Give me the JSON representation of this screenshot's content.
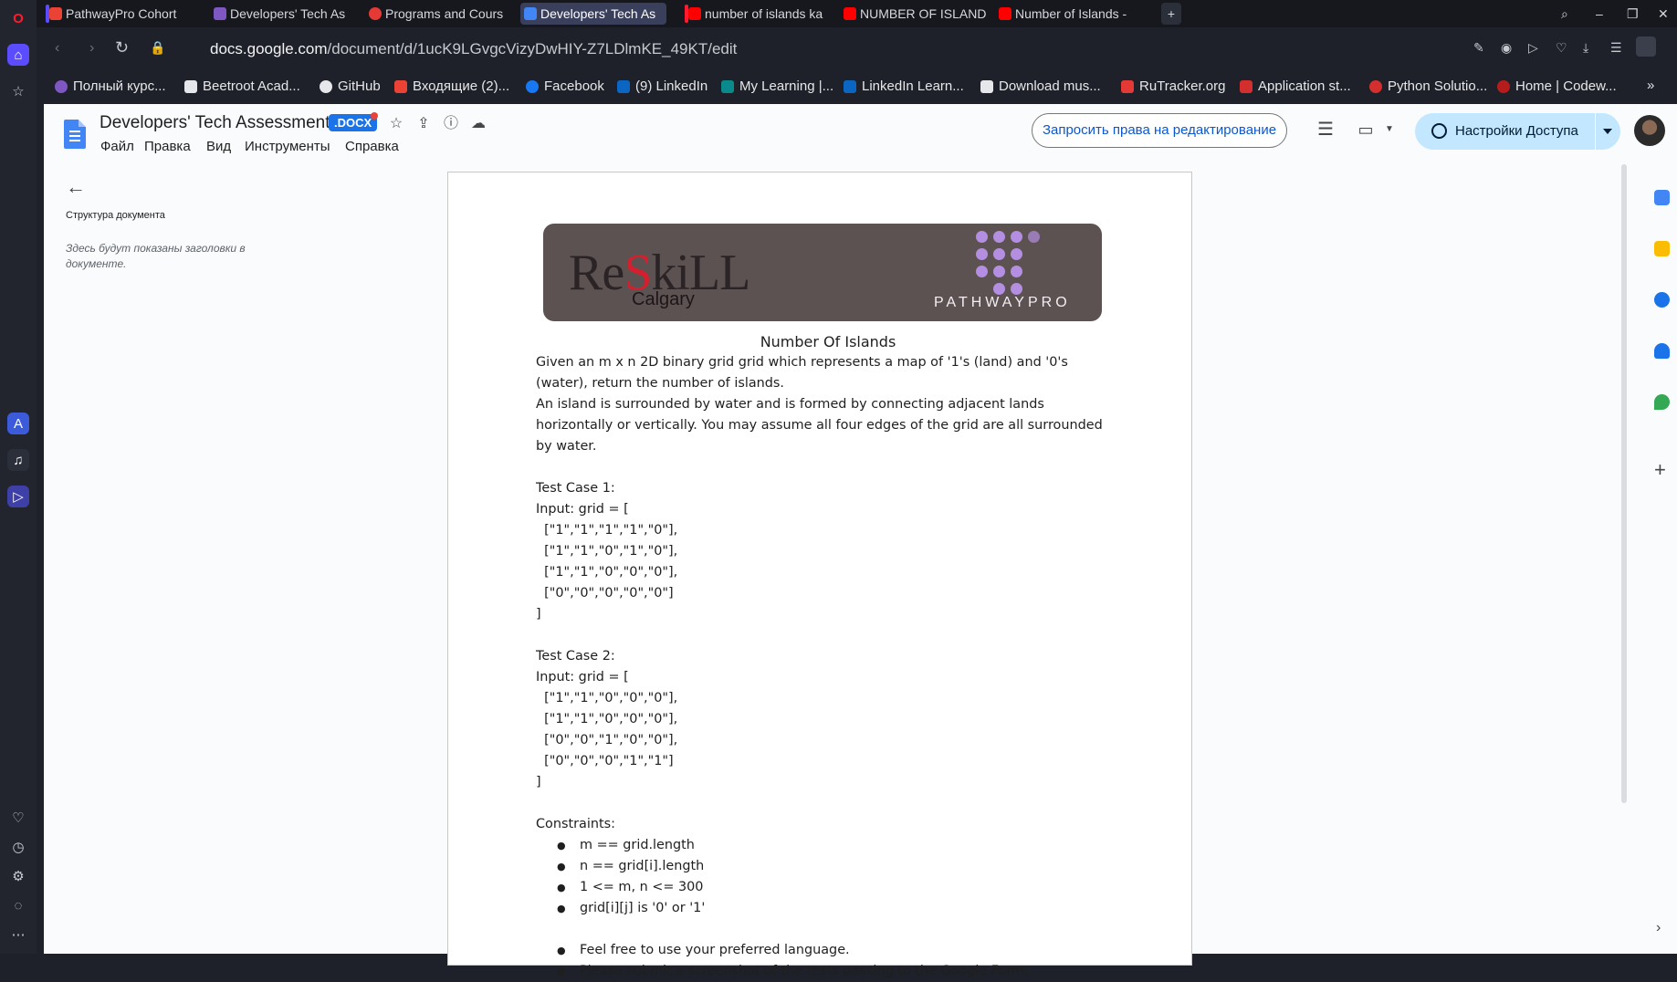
{
  "browser": {
    "tabs": [
      {
        "label": "PathwayPro Cohort",
        "color": "#ea4335"
      },
      {
        "label": "Developers' Tech As",
        "color": "#7e57c2"
      },
      {
        "label": "Programs and Cours",
        "color": "#e53935"
      },
      {
        "label": "Developers' Tech As",
        "color": "#4285f4",
        "active": true
      },
      {
        "label": "number of islands ka",
        "color": "#ff0000"
      },
      {
        "label": "NUMBER OF ISLAND",
        "color": "#ff0000"
      },
      {
        "label": "Number of Islands - ",
        "color": "#ff0000"
      }
    ],
    "new_tab": "+",
    "url_host": "docs.google.com",
    "url_path": "/document/d/1ucK9LGvgcVizyDwHIY-Z7LDlmKE_49KT/edit",
    "bookmarks": [
      {
        "label": "Полный курс...",
        "color": "#7e57c2"
      },
      {
        "label": "Beetroot Acad...",
        "color": "#e6e7ea"
      },
      {
        "label": "GitHub",
        "color": "#e6e7ea"
      },
      {
        "label": "Входящие (2)...",
        "color": "#ea4335"
      },
      {
        "label": "Facebook",
        "color": "#1877f2"
      },
      {
        "label": "(9) LinkedIn",
        "color": "#0a66c2"
      },
      {
        "label": "My Learning |...",
        "color": "#0a8a8a"
      },
      {
        "label": "LinkedIn Learn...",
        "color": "#0a66c2"
      },
      {
        "label": "Download mus...",
        "color": "#e6e7ea"
      },
      {
        "label": "RuTracker.org",
        "color": "#e53935"
      },
      {
        "label": "Application st...",
        "color": "#d32f2f"
      },
      {
        "label": "Python Solutio...",
        "color": "#d32f2f"
      },
      {
        "label": "Home | Codew...",
        "color": "#b71c1c"
      }
    ]
  },
  "docs": {
    "title": "Developers' Tech Assessment",
    "badge": ".DOCX",
    "menu": [
      "Файл",
      "Правка",
      "Вид",
      "Инструменты",
      "Справка"
    ],
    "request_edit": "Запросить права на редактирование",
    "share": "Настройки Доступа",
    "outline_title": "Структура документа",
    "outline_empty": "Здесь будут показаны заголовки в документе."
  },
  "banner": {
    "reskill_left": "Re",
    "reskill_mid": "S",
    "reskill_right": "kiLL",
    "city": "Calgary",
    "brand": "PATHWAYPRO"
  },
  "content": {
    "heading": "Number Of Islands",
    "p1": "Given an m x n 2D binary grid grid which represents a map of '1's (land) and '0's (water), return the number of islands.",
    "p2": "An island is surrounded by water and is formed by connecting adjacent lands horizontally or vertically. You may assume all four edges of the grid are all surrounded by water.",
    "tc1_title": "Test Case 1:",
    "tc1_input": "Input: grid = [",
    "tc1_rows": [
      "  [\"1\",\"1\",\"1\",\"1\",\"0\"],",
      "  [\"1\",\"1\",\"0\",\"1\",\"0\"],",
      "  [\"1\",\"1\",\"0\",\"0\",\"0\"],",
      "  [\"0\",\"0\",\"0\",\"0\",\"0\"]"
    ],
    "tc1_close": "]",
    "tc2_title": "Test Case 2:",
    "tc2_input": "Input: grid = [",
    "tc2_rows": [
      "  [\"1\",\"1\",\"0\",\"0\",\"0\"],",
      "  [\"1\",\"1\",\"0\",\"0\",\"0\"],",
      "  [\"0\",\"0\",\"1\",\"0\",\"0\"],",
      "  [\"0\",\"0\",\"0\",\"1\",\"1\"]"
    ],
    "tc2_close": "]",
    "constraints_title": "Constraints:",
    "constraints": [
      "m == grid.length",
      "n == grid[i].length",
      "1 <= m, n <= 300",
      "grid[i][j] is '0' or '1'"
    ],
    "notes": [
      "Feel free to use your preferred language.",
      "Please submit a screenshot of the tests passing to the Google Form."
    ]
  }
}
